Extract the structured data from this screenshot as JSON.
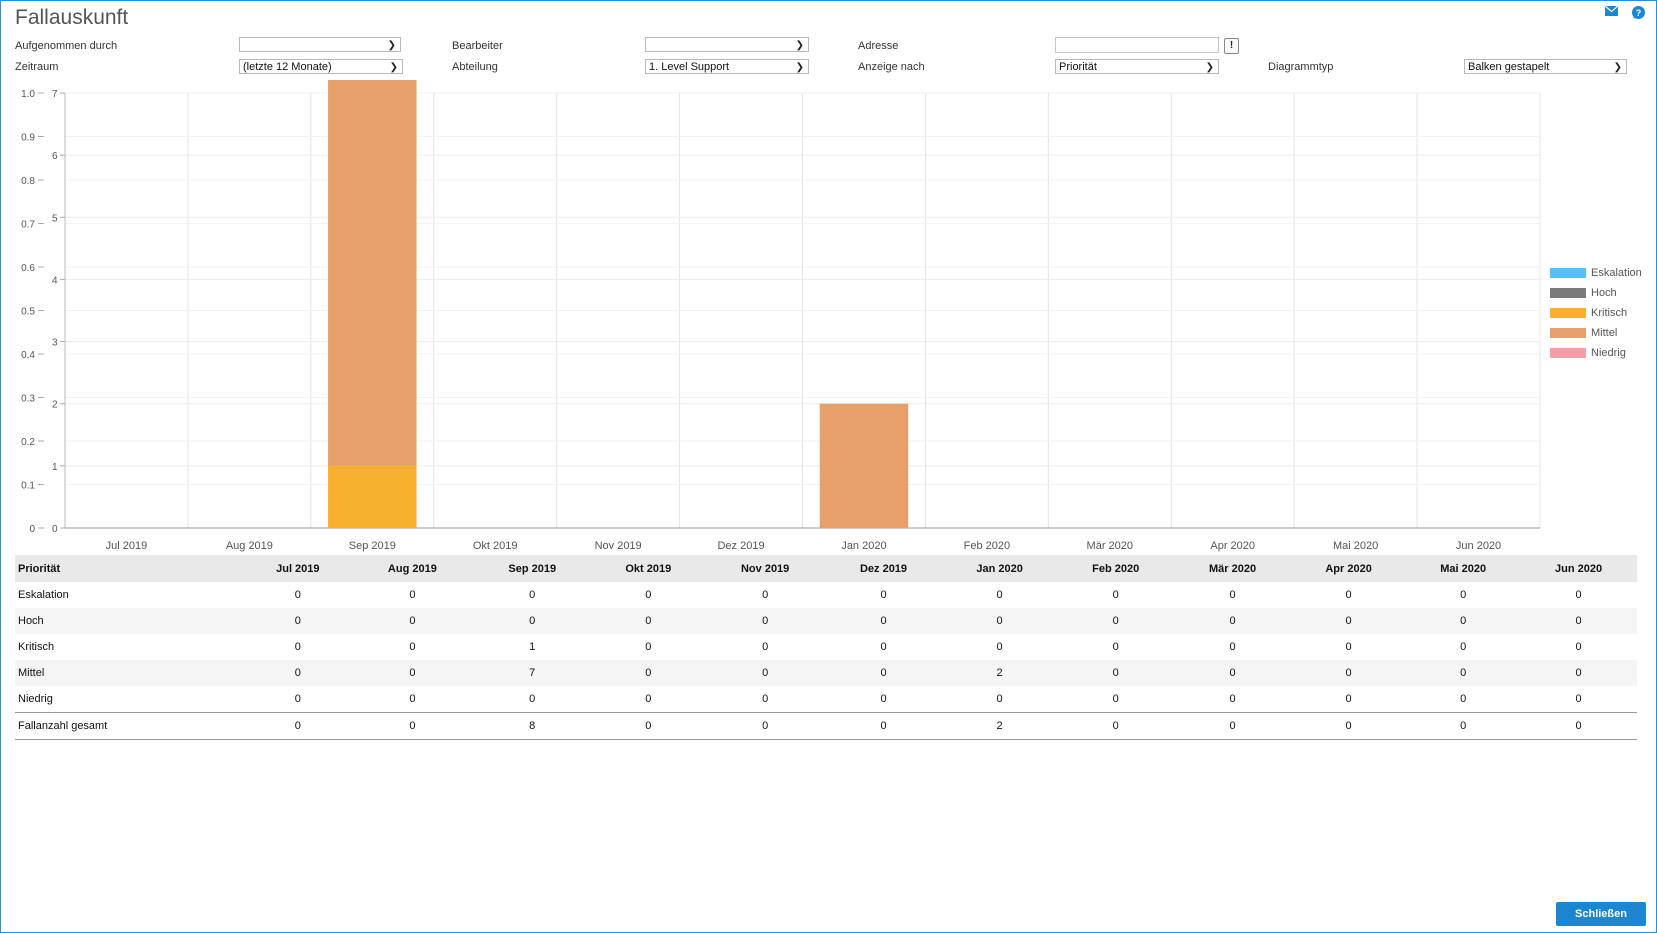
{
  "window": {
    "title": "Fallauskunft"
  },
  "icons": {
    "mail": "mail-icon",
    "info": "info-icon"
  },
  "filters": {
    "aufgenommen_label": "Aufgenommen durch",
    "aufgenommen_value": "",
    "bearbeiter_label": "Bearbeiter",
    "bearbeiter_value": "",
    "adresse_label": "Adresse",
    "adresse_value": "",
    "adresse_button": "!",
    "zeitraum_label": "Zeitraum",
    "zeitraum_value": "(letzte 12 Monate)",
    "abteilung_label": "Abteilung",
    "abteilung_value": "1. Level Support",
    "anzeige_label": "Anzeige nach",
    "anzeige_value": "Priorität",
    "diagrammtyp_label": "Diagrammtyp",
    "diagrammtyp_value": "Balken gestapelt"
  },
  "chart_data": {
    "type": "bar",
    "stacked": true,
    "categories": [
      "Jul 2019",
      "Aug 2019",
      "Sep 2019",
      "Okt 2019",
      "Nov 2019",
      "Dez 2019",
      "Jan 2020",
      "Feb 2020",
      "Mär 2020",
      "Apr 2020",
      "Mai 2020",
      "Jun 2020"
    ],
    "series": [
      {
        "name": "Eskalation",
        "color": "#5bc0f0",
        "values": [
          0,
          0,
          0,
          0,
          0,
          0,
          0,
          0,
          0,
          0,
          0,
          0
        ]
      },
      {
        "name": "Hoch",
        "color": "#7a7a7a",
        "values": [
          0,
          0,
          0,
          0,
          0,
          0,
          0,
          0,
          0,
          0,
          0,
          0
        ]
      },
      {
        "name": "Kritisch",
        "color": "#f7b12e",
        "values": [
          0,
          0,
          1,
          0,
          0,
          0,
          0,
          0,
          0,
          0,
          0,
          0
        ]
      },
      {
        "name": "Mittel",
        "color": "#e8a06a",
        "values": [
          0,
          0,
          7,
          0,
          0,
          0,
          2,
          0,
          0,
          0,
          0,
          0
        ]
      },
      {
        "name": "Niedrig",
        "color": "#f0a0a8",
        "values": [
          0,
          0,
          0,
          0,
          0,
          0,
          0,
          0,
          0,
          0,
          0,
          0
        ]
      }
    ],
    "ylim": [
      0,
      7
    ],
    "yticks": [
      "0",
      "1",
      "2",
      "3",
      "4",
      "5",
      "6",
      "7"
    ],
    "y2lim": [
      0,
      1.0
    ],
    "y2ticks": [
      "0",
      "0.1",
      "0.2",
      "0.3",
      "0.4",
      "0.5",
      "0.6",
      "0.7",
      "0.8",
      "0.9",
      "1.0"
    ],
    "grid": true,
    "legend_position": "right"
  },
  "table": {
    "header_label": "Priorität",
    "months": [
      "Jul 2019",
      "Aug 2019",
      "Sep 2019",
      "Okt 2019",
      "Nov 2019",
      "Dez 2019",
      "Jan 2020",
      "Feb 2020",
      "Mär 2020",
      "Apr 2020",
      "Mai 2020",
      "Jun 2020"
    ],
    "rows": [
      {
        "label": "Eskalation",
        "values": [
          "0",
          "0",
          "0",
          "0",
          "0",
          "0",
          "0",
          "0",
          "0",
          "0",
          "0",
          "0"
        ]
      },
      {
        "label": "Hoch",
        "values": [
          "0",
          "0",
          "0",
          "0",
          "0",
          "0",
          "0",
          "0",
          "0",
          "0",
          "0",
          "0"
        ]
      },
      {
        "label": "Kritisch",
        "values": [
          "0",
          "0",
          "1",
          "0",
          "0",
          "0",
          "0",
          "0",
          "0",
          "0",
          "0",
          "0"
        ]
      },
      {
        "label": "Mittel",
        "values": [
          "0",
          "0",
          "7",
          "0",
          "0",
          "0",
          "2",
          "0",
          "0",
          "0",
          "0",
          "0"
        ]
      },
      {
        "label": "Niedrig",
        "values": [
          "0",
          "0",
          "0",
          "0",
          "0",
          "0",
          "0",
          "0",
          "0",
          "0",
          "0",
          "0"
        ]
      }
    ],
    "total": {
      "label": "Fallanzahl gesamt",
      "values": [
        "0",
        "0",
        "8",
        "0",
        "0",
        "0",
        "2",
        "0",
        "0",
        "0",
        "0",
        "0"
      ]
    }
  },
  "footer": {
    "close_label": "Schließen"
  }
}
